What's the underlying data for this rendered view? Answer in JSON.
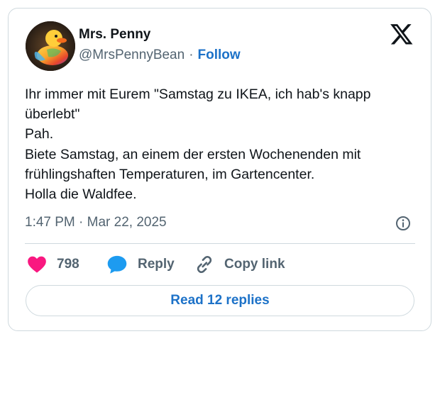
{
  "author": {
    "name": "Mrs. Penny",
    "handle": "@MrsPennyBean",
    "separator": "·",
    "follow_label": "Follow"
  },
  "tweet": {
    "lines": [
      "Ihr immer mit Eurem \"Samstag zu IKEA, ich hab's knapp",
      "überlebt\"",
      "Pah.",
      "Biete Samstag, an einem der ersten Wochenenden mit",
      "frühlingshaften Temperaturen, im Gartencenter.",
      "Holla die Waldfee."
    ],
    "timestamp": "1:47 PM · Mar 22, 2025"
  },
  "actions": {
    "likes_count": "798",
    "reply_label": "Reply",
    "copy_link_label": "Copy link"
  },
  "read_replies_label": "Read 12 replies",
  "icons": {
    "platform": "x-logo-icon",
    "info": "info-icon",
    "like": "heart-icon",
    "reply": "speech-bubble-icon",
    "copy": "link-icon"
  },
  "colors": {
    "accent": "#1d72c8",
    "like": "#f91880",
    "reply_icon": "#1d9bf0",
    "muted": "#536471",
    "border": "#cfd9de"
  }
}
